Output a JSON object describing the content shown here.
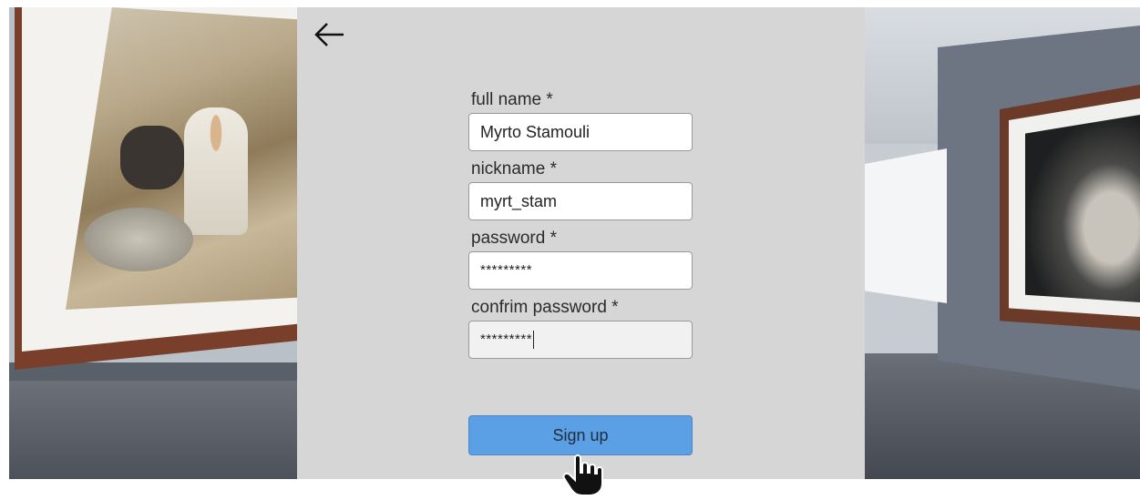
{
  "form": {
    "fields": [
      {
        "label": "full name *",
        "value": "Myrto Stamouli"
      },
      {
        "label": "nickname *",
        "value": "myrt_stam"
      },
      {
        "label": "password *",
        "value": "*********"
      },
      {
        "label": "confrim password *",
        "value": "*********"
      }
    ],
    "submit_label": "Sign up"
  },
  "icons": {
    "back": "arrow-left-icon",
    "pointer": "hand-pointer-icon"
  },
  "colors": {
    "panel_bg": "#d6d6d6",
    "button_bg": "#5b9fe4"
  }
}
